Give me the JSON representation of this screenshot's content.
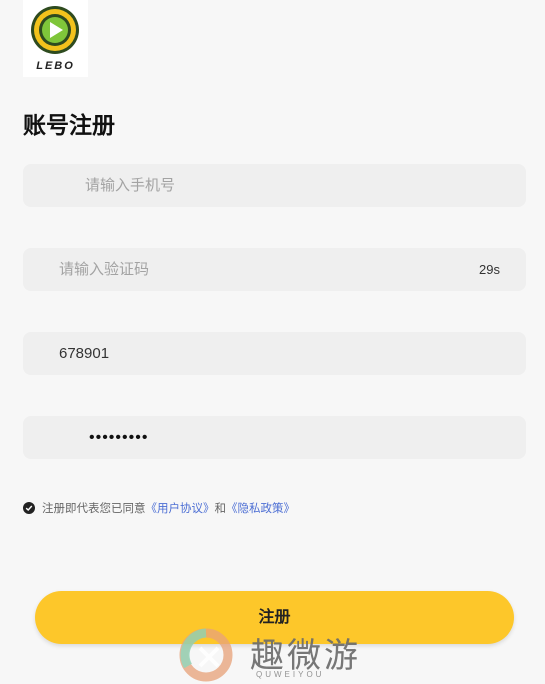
{
  "logo": {
    "text": "LEBO",
    "icon": "play-icon"
  },
  "page_title": "账号注册",
  "phone_field": {
    "placeholder": "请输入手机号",
    "value": ""
  },
  "code_field": {
    "placeholder": "请输入验证码",
    "value": "",
    "countdown": "29s"
  },
  "username_field": {
    "value": "678901"
  },
  "password_field": {
    "value": "•••••••••"
  },
  "agreement": {
    "checked": true,
    "prefix": "注册即代表您已同意",
    "user_agreement": "《用户协议》",
    "and": "和",
    "privacy_policy": "《隐私政策》"
  },
  "submit_label": "注册",
  "watermark": {
    "text": "趣微游",
    "sub": "QUWEIYOU"
  },
  "colors": {
    "accent": "#fdc72a",
    "link": "#4d6fd4",
    "field_bg": "#efefef"
  }
}
